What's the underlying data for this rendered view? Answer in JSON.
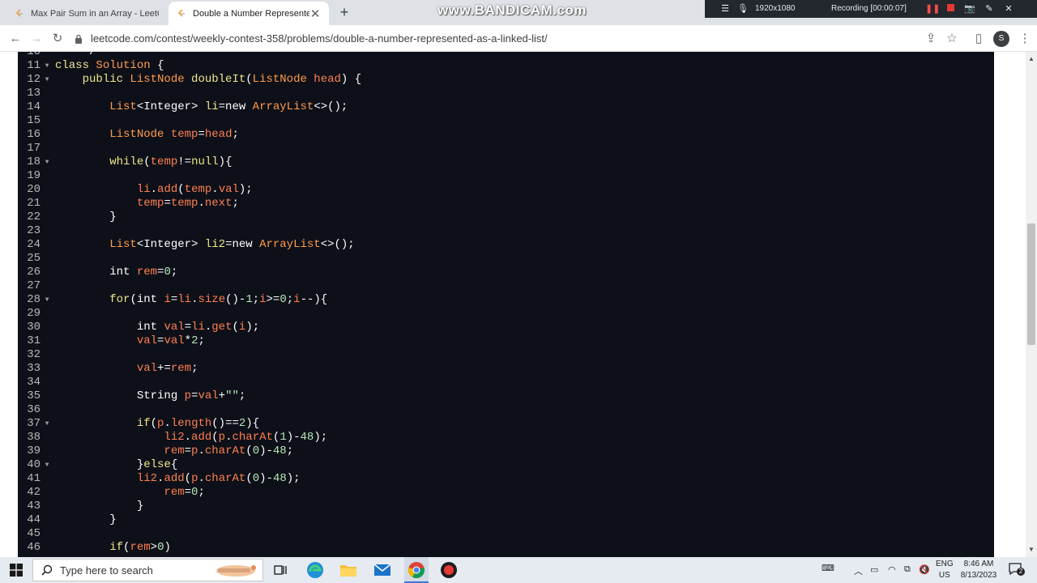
{
  "browser": {
    "tabs": [
      {
        "title": "Max Pair Sum in an Array - LeetC",
        "active": false
      },
      {
        "title": "Double a Number Represented a",
        "active": true
      }
    ],
    "url": "leetcode.com/contest/weekly-contest-358/problems/double-a-number-represented-as-a-linked-list/",
    "profile_initial": "S"
  },
  "recorder": {
    "watermark": "www.BANDICAM.com",
    "resolution": "1920x1080",
    "status": "Recording [00:00:07]"
  },
  "editor": {
    "lines": [
      {
        "n": "10",
        "fold": false,
        "tokens": [
          [
            "    */",
            "pl"
          ]
        ]
      },
      {
        "n": "11",
        "fold": true,
        "tokens": [
          [
            "class ",
            "kw"
          ],
          [
            "Solution",
            "ty"
          ],
          [
            " {",
            "pl"
          ]
        ]
      },
      {
        "n": "12",
        "fold": true,
        "tokens": [
          [
            "    ",
            "pl"
          ],
          [
            "public ",
            "kw"
          ],
          [
            "ListNode ",
            "ty"
          ],
          [
            "doubleIt",
            "kw"
          ],
          [
            "(",
            "pl"
          ],
          [
            "ListNode ",
            "ty"
          ],
          [
            "head",
            "id"
          ],
          [
            ") {",
            "pl"
          ]
        ]
      },
      {
        "n": "13",
        "fold": false,
        "tokens": []
      },
      {
        "n": "14",
        "fold": false,
        "tokens": [
          [
            "        ",
            "pl"
          ],
          [
            "List",
            "ty"
          ],
          [
            "<Integer> ",
            "pl"
          ],
          [
            "li",
            "kw"
          ],
          [
            "=new ",
            "pl"
          ],
          [
            "ArrayList",
            "ty"
          ],
          [
            "<>();",
            "pl"
          ]
        ]
      },
      {
        "n": "15",
        "fold": false,
        "tokens": []
      },
      {
        "n": "16",
        "fold": false,
        "tokens": [
          [
            "        ",
            "pl"
          ],
          [
            "ListNode ",
            "ty"
          ],
          [
            "temp",
            "id"
          ],
          [
            "=",
            "pl"
          ],
          [
            "head",
            "id"
          ],
          [
            ";",
            "pl"
          ]
        ]
      },
      {
        "n": "17",
        "fold": false,
        "tokens": []
      },
      {
        "n": "18",
        "fold": true,
        "tokens": [
          [
            "        ",
            "pl"
          ],
          [
            "while",
            "kw"
          ],
          [
            "(",
            "pl"
          ],
          [
            "temp",
            "id"
          ],
          [
            "!=",
            "pl"
          ],
          [
            "null",
            "kw"
          ],
          [
            "){",
            "pl"
          ]
        ]
      },
      {
        "n": "19",
        "fold": false,
        "tokens": []
      },
      {
        "n": "20",
        "fold": false,
        "tokens": [
          [
            "            ",
            "pl"
          ],
          [
            "li",
            "id"
          ],
          [
            ".",
            "pl"
          ],
          [
            "add",
            "id"
          ],
          [
            "(",
            "pl"
          ],
          [
            "temp",
            "id"
          ],
          [
            ".",
            "pl"
          ],
          [
            "val",
            "id"
          ],
          [
            ");",
            "pl"
          ]
        ]
      },
      {
        "n": "21",
        "fold": false,
        "tokens": [
          [
            "            ",
            "pl"
          ],
          [
            "temp",
            "id"
          ],
          [
            "=",
            "pl"
          ],
          [
            "temp",
            "id"
          ],
          [
            ".",
            "pl"
          ],
          [
            "next",
            "id"
          ],
          [
            ";",
            "pl"
          ]
        ]
      },
      {
        "n": "22",
        "fold": false,
        "tokens": [
          [
            "        }",
            "pl"
          ]
        ]
      },
      {
        "n": "23",
        "fold": false,
        "tokens": []
      },
      {
        "n": "24",
        "fold": false,
        "tokens": [
          [
            "        ",
            "pl"
          ],
          [
            "List",
            "ty"
          ],
          [
            "<Integer> ",
            "pl"
          ],
          [
            "li2",
            "kw"
          ],
          [
            "=new ",
            "pl"
          ],
          [
            "ArrayList",
            "ty"
          ],
          [
            "<>();",
            "pl"
          ]
        ]
      },
      {
        "n": "25",
        "fold": false,
        "tokens": []
      },
      {
        "n": "26",
        "fold": false,
        "tokens": [
          [
            "        ",
            "pl"
          ],
          [
            "int ",
            "pl"
          ],
          [
            "rem",
            "id"
          ],
          [
            "=",
            "pl"
          ],
          [
            "0",
            "nm"
          ],
          [
            ";",
            "pl"
          ]
        ]
      },
      {
        "n": "27",
        "fold": false,
        "tokens": []
      },
      {
        "n": "28",
        "fold": true,
        "tokens": [
          [
            "        ",
            "pl"
          ],
          [
            "for",
            "kw"
          ],
          [
            "(",
            "pl"
          ],
          [
            "int ",
            "pl"
          ],
          [
            "i",
            "id"
          ],
          [
            "=",
            "pl"
          ],
          [
            "li",
            "id"
          ],
          [
            ".",
            "pl"
          ],
          [
            "size",
            "id"
          ],
          [
            "()-",
            "pl"
          ],
          [
            "1",
            "nm"
          ],
          [
            ";",
            "pl"
          ],
          [
            "i",
            "id"
          ],
          [
            ">=",
            "pl"
          ],
          [
            "0",
            "nm"
          ],
          [
            ";",
            "pl"
          ],
          [
            "i",
            "id"
          ],
          [
            "--){",
            "pl"
          ]
        ]
      },
      {
        "n": "29",
        "fold": false,
        "tokens": []
      },
      {
        "n": "30",
        "fold": false,
        "tokens": [
          [
            "            ",
            "pl"
          ],
          [
            "int ",
            "pl"
          ],
          [
            "val",
            "id"
          ],
          [
            "=",
            "pl"
          ],
          [
            "li",
            "id"
          ],
          [
            ".",
            "pl"
          ],
          [
            "get",
            "id"
          ],
          [
            "(",
            "pl"
          ],
          [
            "i",
            "id"
          ],
          [
            ");",
            "pl"
          ]
        ]
      },
      {
        "n": "31",
        "fold": false,
        "tokens": [
          [
            "            ",
            "pl"
          ],
          [
            "val",
            "id"
          ],
          [
            "=",
            "pl"
          ],
          [
            "val",
            "id"
          ],
          [
            "*",
            "pl"
          ],
          [
            "2",
            "nm"
          ],
          [
            ";",
            "pl"
          ]
        ]
      },
      {
        "n": "32",
        "fold": false,
        "tokens": []
      },
      {
        "n": "33",
        "fold": false,
        "tokens": [
          [
            "            ",
            "pl"
          ],
          [
            "val",
            "id"
          ],
          [
            "+=",
            "pl"
          ],
          [
            "rem",
            "id"
          ],
          [
            ";",
            "pl"
          ]
        ]
      },
      {
        "n": "34",
        "fold": false,
        "tokens": []
      },
      {
        "n": "35",
        "fold": false,
        "tokens": [
          [
            "            ",
            "pl"
          ],
          [
            "String ",
            "pl"
          ],
          [
            "p",
            "id"
          ],
          [
            "=",
            "pl"
          ],
          [
            "val",
            "id"
          ],
          [
            "+",
            "pl"
          ],
          [
            "\"\"",
            "nm"
          ],
          [
            ";",
            "pl"
          ]
        ]
      },
      {
        "n": "36",
        "fold": false,
        "tokens": []
      },
      {
        "n": "37",
        "fold": true,
        "tokens": [
          [
            "            ",
            "pl"
          ],
          [
            "if",
            "kw"
          ],
          [
            "(",
            "pl"
          ],
          [
            "p",
            "id"
          ],
          [
            ".",
            "pl"
          ],
          [
            "length",
            "id"
          ],
          [
            "()==",
            "pl"
          ],
          [
            "2",
            "nm"
          ],
          [
            "){",
            "pl"
          ]
        ]
      },
      {
        "n": "38",
        "fold": false,
        "tokens": [
          [
            "                ",
            "pl"
          ],
          [
            "li2",
            "id"
          ],
          [
            ".",
            "pl"
          ],
          [
            "add",
            "id"
          ],
          [
            "(",
            "pl"
          ],
          [
            "p",
            "id"
          ],
          [
            ".",
            "pl"
          ],
          [
            "charAt",
            "id"
          ],
          [
            "(",
            "pl"
          ],
          [
            "1",
            "nm"
          ],
          [
            ")-",
            "pl"
          ],
          [
            "48",
            "nm"
          ],
          [
            ");",
            "pl"
          ]
        ]
      },
      {
        "n": "39",
        "fold": false,
        "tokens": [
          [
            "                ",
            "pl"
          ],
          [
            "rem",
            "id"
          ],
          [
            "=",
            "pl"
          ],
          [
            "p",
            "id"
          ],
          [
            ".",
            "pl"
          ],
          [
            "charAt",
            "id"
          ],
          [
            "(",
            "pl"
          ],
          [
            "0",
            "nm"
          ],
          [
            ")-",
            "pl"
          ],
          [
            "48",
            "nm"
          ],
          [
            ";",
            "pl"
          ]
        ]
      },
      {
        "n": "40",
        "fold": true,
        "tokens": [
          [
            "            }",
            "pl"
          ],
          [
            "else",
            "kw"
          ],
          [
            "{",
            "pl"
          ]
        ]
      },
      {
        "n": "41",
        "fold": false,
        "tokens": [
          [
            "            ",
            "pl"
          ],
          [
            "li2",
            "id"
          ],
          [
            ".",
            "pl"
          ],
          [
            "add",
            "id"
          ],
          [
            "(",
            "pl"
          ],
          [
            "p",
            "id"
          ],
          [
            ".",
            "pl"
          ],
          [
            "charAt",
            "id"
          ],
          [
            "(",
            "pl"
          ],
          [
            "0",
            "nm"
          ],
          [
            ")-",
            "pl"
          ],
          [
            "48",
            "nm"
          ],
          [
            ");",
            "pl"
          ]
        ]
      },
      {
        "n": "42",
        "fold": false,
        "tokens": [
          [
            "                ",
            "pl"
          ],
          [
            "rem",
            "id"
          ],
          [
            "=",
            "pl"
          ],
          [
            "0",
            "nm"
          ],
          [
            ";",
            "pl"
          ]
        ]
      },
      {
        "n": "43",
        "fold": false,
        "tokens": [
          [
            "            }",
            "pl"
          ]
        ]
      },
      {
        "n": "44",
        "fold": false,
        "tokens": [
          [
            "        }",
            "pl"
          ]
        ]
      },
      {
        "n": "45",
        "fold": false,
        "tokens": []
      },
      {
        "n": "46",
        "fold": false,
        "tokens": [
          [
            "        ",
            "pl"
          ],
          [
            "if",
            "kw"
          ],
          [
            "(",
            "pl"
          ],
          [
            "rem",
            "id"
          ],
          [
            ">",
            "pl"
          ],
          [
            "0",
            "nm"
          ],
          [
            ")",
            "pl"
          ]
        ]
      }
    ]
  },
  "taskbar": {
    "search_placeholder": "Type here to search",
    "lang_line1": "ENG",
    "lang_line2": "US",
    "time": "8:46 AM",
    "date": "8/13/2023",
    "notification_count": "2"
  },
  "colors": {
    "editor_bg": "#0e1019",
    "keyword": "#f0e68c",
    "type": "#ff9b4a",
    "identifier": "#ff7f50",
    "number": "#b5e8b5"
  }
}
